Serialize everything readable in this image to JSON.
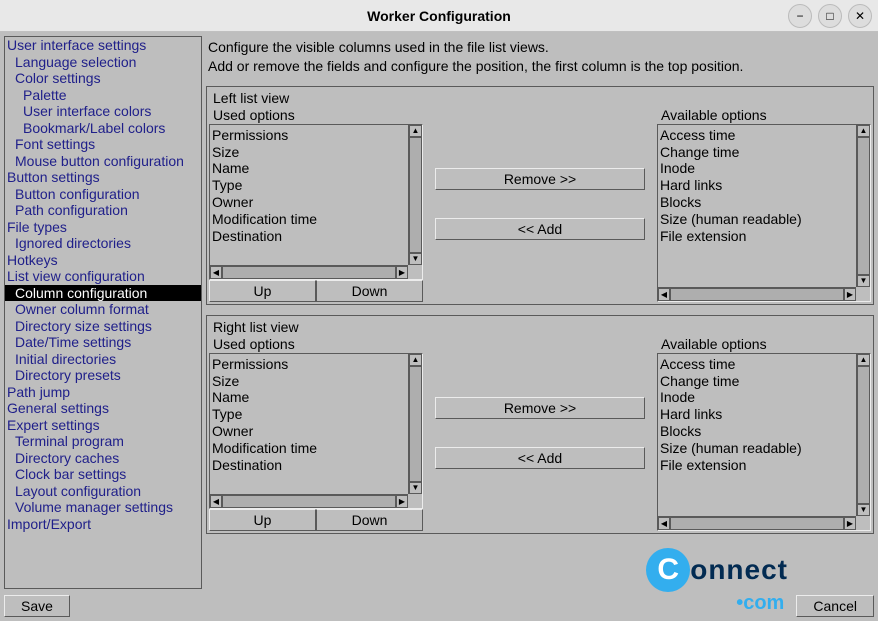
{
  "window": {
    "title": "Worker Configuration"
  },
  "sidebar": {
    "items": [
      {
        "label": "User interface settings",
        "indent": 0
      },
      {
        "label": "Language selection",
        "indent": 1
      },
      {
        "label": "Color settings",
        "indent": 1
      },
      {
        "label": "Palette",
        "indent": 2
      },
      {
        "label": "User interface colors",
        "indent": 2
      },
      {
        "label": "Bookmark/Label colors",
        "indent": 2
      },
      {
        "label": "Font settings",
        "indent": 1
      },
      {
        "label": "Mouse button configuration",
        "indent": 1
      },
      {
        "label": "Button settings",
        "indent": 0
      },
      {
        "label": "Button configuration",
        "indent": 1
      },
      {
        "label": "Path configuration",
        "indent": 1
      },
      {
        "label": "File types",
        "indent": 0
      },
      {
        "label": "Ignored directories",
        "indent": 1
      },
      {
        "label": "Hotkeys",
        "indent": 0
      },
      {
        "label": "List view configuration",
        "indent": 0
      },
      {
        "label": "Column configuration",
        "indent": 1,
        "selected": true
      },
      {
        "label": "Owner column format",
        "indent": 1
      },
      {
        "label": "Directory size settings",
        "indent": 1
      },
      {
        "label": "Date/Time settings",
        "indent": 1
      },
      {
        "label": "Initial directories",
        "indent": 1
      },
      {
        "label": "Directory presets",
        "indent": 1
      },
      {
        "label": "Path jump",
        "indent": 0
      },
      {
        "label": "General settings",
        "indent": 0
      },
      {
        "label": "Expert settings",
        "indent": 0
      },
      {
        "label": "Terminal program",
        "indent": 1
      },
      {
        "label": "Directory caches",
        "indent": 1
      },
      {
        "label": "Clock bar settings",
        "indent": 1
      },
      {
        "label": "Layout configuration",
        "indent": 1
      },
      {
        "label": "Volume manager settings",
        "indent": 1
      },
      {
        "label": "Import/Export",
        "indent": 0
      }
    ]
  },
  "desc": {
    "line1": "Configure the visible columns used in the file list views.",
    "line2": "Add or remove the fields and configure the position, the first column is the top position."
  },
  "labels": {
    "used": "Used options",
    "avail": "Available options",
    "up": "Up",
    "down": "Down",
    "remove": "Remove >>",
    "add": "<< Add",
    "save": "Save",
    "cancel": "Cancel"
  },
  "panels": [
    {
      "title": "Left list view",
      "used": [
        "Permissions",
        "Size",
        "Name",
        "Type",
        "Owner",
        "Modification time",
        "Destination"
      ],
      "avail": [
        "Access time",
        "Change time",
        "Inode",
        "Hard links",
        "Blocks",
        "Size (human readable)",
        "File extension"
      ]
    },
    {
      "title": "Right list view",
      "used": [
        "Permissions",
        "Size",
        "Name",
        "Type",
        "Owner",
        "Modification time",
        "Destination"
      ],
      "avail": [
        "Access time",
        "Change time",
        "Inode",
        "Hard links",
        "Blocks",
        "Size (human readable)",
        "File extension"
      ]
    }
  ]
}
